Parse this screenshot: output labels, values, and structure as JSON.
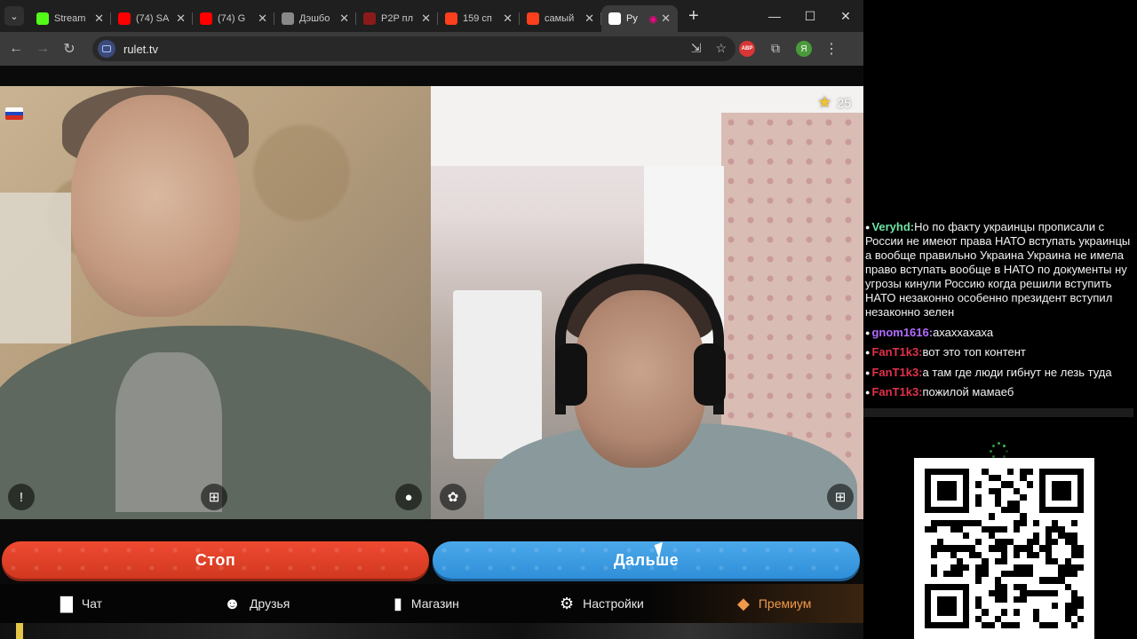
{
  "browser": {
    "tabs": [
      {
        "title": "Stream",
        "favicon": "kick-icon",
        "color": "#53fc18",
        "active": false
      },
      {
        "title": "(74) SA",
        "favicon": "youtube-icon",
        "color": "#ff0000",
        "active": false
      },
      {
        "title": "(74) G",
        "favicon": "youtube-icon",
        "color": "#ff0000",
        "active": false
      },
      {
        "title": "Дэшбо",
        "favicon": "dashboard-icon",
        "color": "#888888",
        "active": false
      },
      {
        "title": "P2P пл",
        "favicon": "p2p-icon",
        "color": "#8b1a1a",
        "active": false
      },
      {
        "title": "159 сп",
        "favicon": "yandex-icon",
        "color": "#fc3f1d",
        "active": false
      },
      {
        "title": "самый",
        "favicon": "yandex-icon",
        "color": "#fc3f1d",
        "active": false
      },
      {
        "title": "Ру",
        "favicon": "rulet-icon",
        "color": "#ffffff",
        "active": true
      }
    ],
    "url": "rulet.tv",
    "profile_letter": "Я",
    "adblock_label": "ABP"
  },
  "video": {
    "rating": "25",
    "flag_colors": [
      "#ffffff",
      "#1f47c0",
      "#d52b1e"
    ]
  },
  "actions": {
    "stop_label": "Стоп",
    "next_label": "Дальше"
  },
  "nav": {
    "chat": "Чат",
    "friends": "Друзья",
    "shop": "Магазин",
    "settings": "Настройки",
    "premium": "Премиум"
  },
  "chat": {
    "messages": [
      {
        "user": "Veryhd:",
        "color": "#6fe3a4",
        "text": "Но по факту украинцы прописали с России не имеют права НАТО вступать украинцы а вообще правильно Украина Украина не имела право вступать вообще в НАТО по документы ну угрозы кинули Россию когда решили вступить НАТО незаконно особенно президент вступил незаконно зелен"
      },
      {
        "user": "gnom1616:",
        "color": "#b26bff",
        "text": "ахаххахаха"
      },
      {
        "user": "FanT1k3:",
        "color": "#e0324b",
        "text": "вот это топ контент"
      },
      {
        "user": "FanT1k3:",
        "color": "#e0324b",
        "text": "а там где люди гибнут не лезь туда"
      },
      {
        "user": "FanT1k3:",
        "color": "#e0324b",
        "text": "пожилой мамаеб"
      }
    ]
  },
  "colors": {
    "stop": "#e5432b",
    "next": "#3a9be2",
    "premium": "#f39a4a"
  }
}
